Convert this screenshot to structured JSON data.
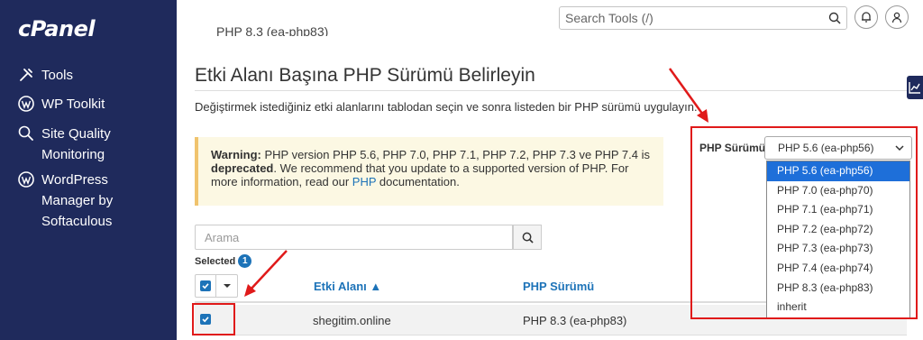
{
  "app": {
    "logo": "cPanel"
  },
  "sidebar": {
    "items": [
      {
        "label": "Tools",
        "icon": "tools-icon"
      },
      {
        "label": "WP Toolkit",
        "icon": "wordpress-icon"
      },
      {
        "label": "Site Quality\nMonitoring",
        "icon": "magnifier-icon"
      },
      {
        "label": "WordPress\nManager by\nSoftaculous",
        "icon": "wordpress-icon"
      }
    ]
  },
  "header": {
    "search_placeholder": "Search Tools (/)"
  },
  "main": {
    "partial_text": "PHP 8.3 (ea-php83)",
    "title": "Etki Alanı Başına PHP Sürümü Belirleyin",
    "description": "Değiştirmek istediğiniz etki alanlarını tablodan seçin ve sonra listeden bir PHP sürümü uygulayın.",
    "warning": {
      "label": "Warning:",
      "text1": " PHP version PHP 5.6, PHP 7.0, PHP 7.1, PHP 7.2, PHP 7.3 ve PHP 7.4 is ",
      "deprecated": "deprecated",
      "text2": ". We recommend that you update to a supported version of PHP. For more information, read our ",
      "link": "PHP",
      "text3": " documentation."
    },
    "search": {
      "placeholder": "Arama"
    },
    "selected": {
      "label": "Selected",
      "count": "1"
    },
    "table": {
      "columns": [
        "Etki Alanı ▲",
        "PHP Sürümü"
      ],
      "rows": [
        {
          "domain": "shegitim.online",
          "php": "PHP 8.3 (ea-php83)",
          "checked": true
        }
      ]
    },
    "php_select": {
      "label": "PHP Sürümü",
      "value": "PHP 5.6 (ea-php56)",
      "options": [
        "PHP 5.6 (ea-php56)",
        "PHP 7.0 (ea-php70)",
        "PHP 7.1 (ea-php71)",
        "PHP 7.2 (ea-php72)",
        "PHP 7.3 (ea-php73)",
        "PHP 7.4 (ea-php74)",
        "PHP 8.3 (ea-php83)",
        "inherit"
      ]
    }
  },
  "colors": {
    "sidebar": "#1f2a5c",
    "accent": "#1d73b8",
    "annotation": "#e01a1a",
    "option_selected": "#1e6fd9"
  }
}
